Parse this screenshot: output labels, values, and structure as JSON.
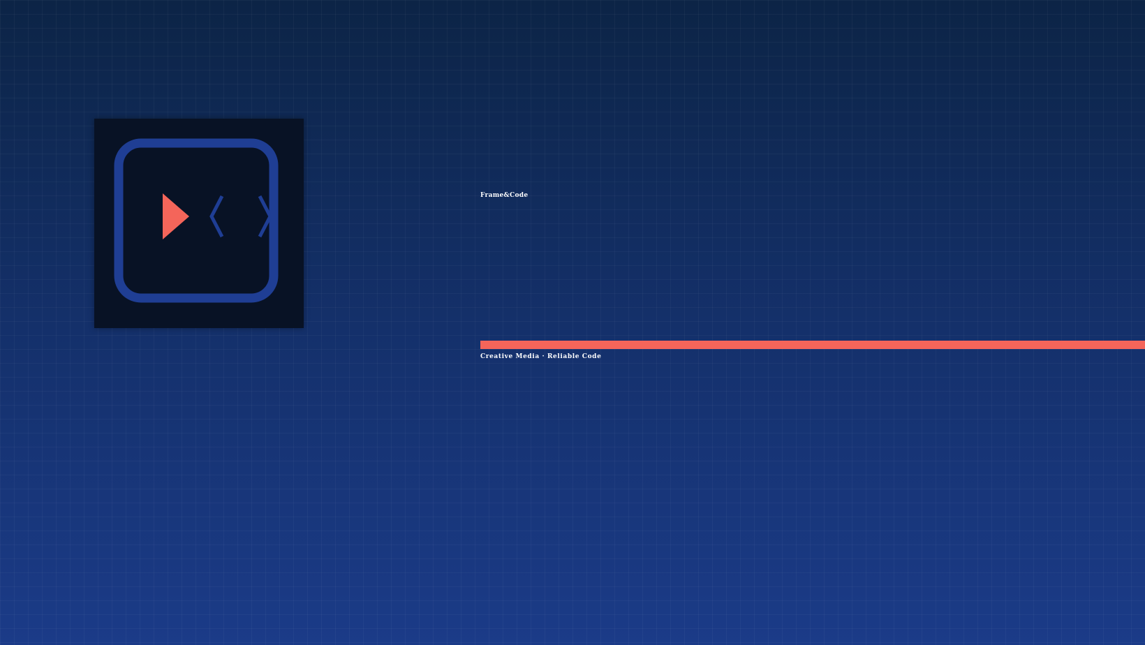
{
  "brand": {
    "name": "Frame&Code",
    "tagline": "Creative Media · Reliable Code"
  },
  "logo": {
    "icons": [
      "rounded-frame-icon",
      "play-icon",
      "chevron-left-icon",
      "chevron-right-icon"
    ]
  },
  "colors": {
    "background_top": "#0c2446",
    "background_bottom": "#1b3b88",
    "tile": "#081225",
    "frame": "#1f3e94",
    "accent": "#f4655a",
    "text": "#ffffff"
  }
}
